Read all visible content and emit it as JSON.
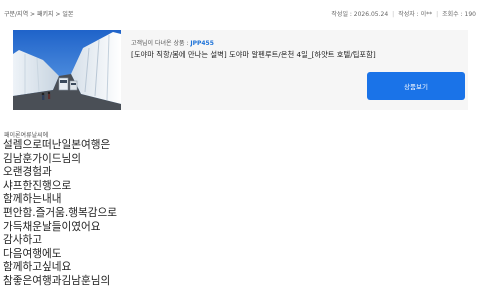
{
  "breadcrumb": "구분/지역 > 패키지 > 일본",
  "post_info": {
    "date_label": "작성일 : 2026.05.24",
    "author_label": "작성자 : 이**",
    "views_label": "조회수 : 190"
  },
  "product": {
    "code_prefix": "고객님이 다녀온 상품 : ",
    "code": "JPP455",
    "name": "[도야마 직항/봄에 만나는 설벽] 도야마 알펜루트/온천 4일_[하얏트 호텔/팁포함]",
    "button_label": "상품보기",
    "image_icon": "snow-wall-road-photo"
  },
  "review": {
    "author_line": "패이론여류날씨에",
    "lines": [
      "설렘으로떠난일본여행은",
      "김남훈가이드님의",
      "오랜경험과",
      "샤프한진행으로",
      "함께하는내내",
      "편안함.즐거움.행복감으로",
      "가득채운날들이였어요",
      "감사하고",
      "다음여행에도",
      "함께하고싶네요",
      "참좋은여행과김남훈님의"
    ]
  },
  "colors": {
    "accent": "#1a73e8",
    "code": "#1e73d8"
  }
}
